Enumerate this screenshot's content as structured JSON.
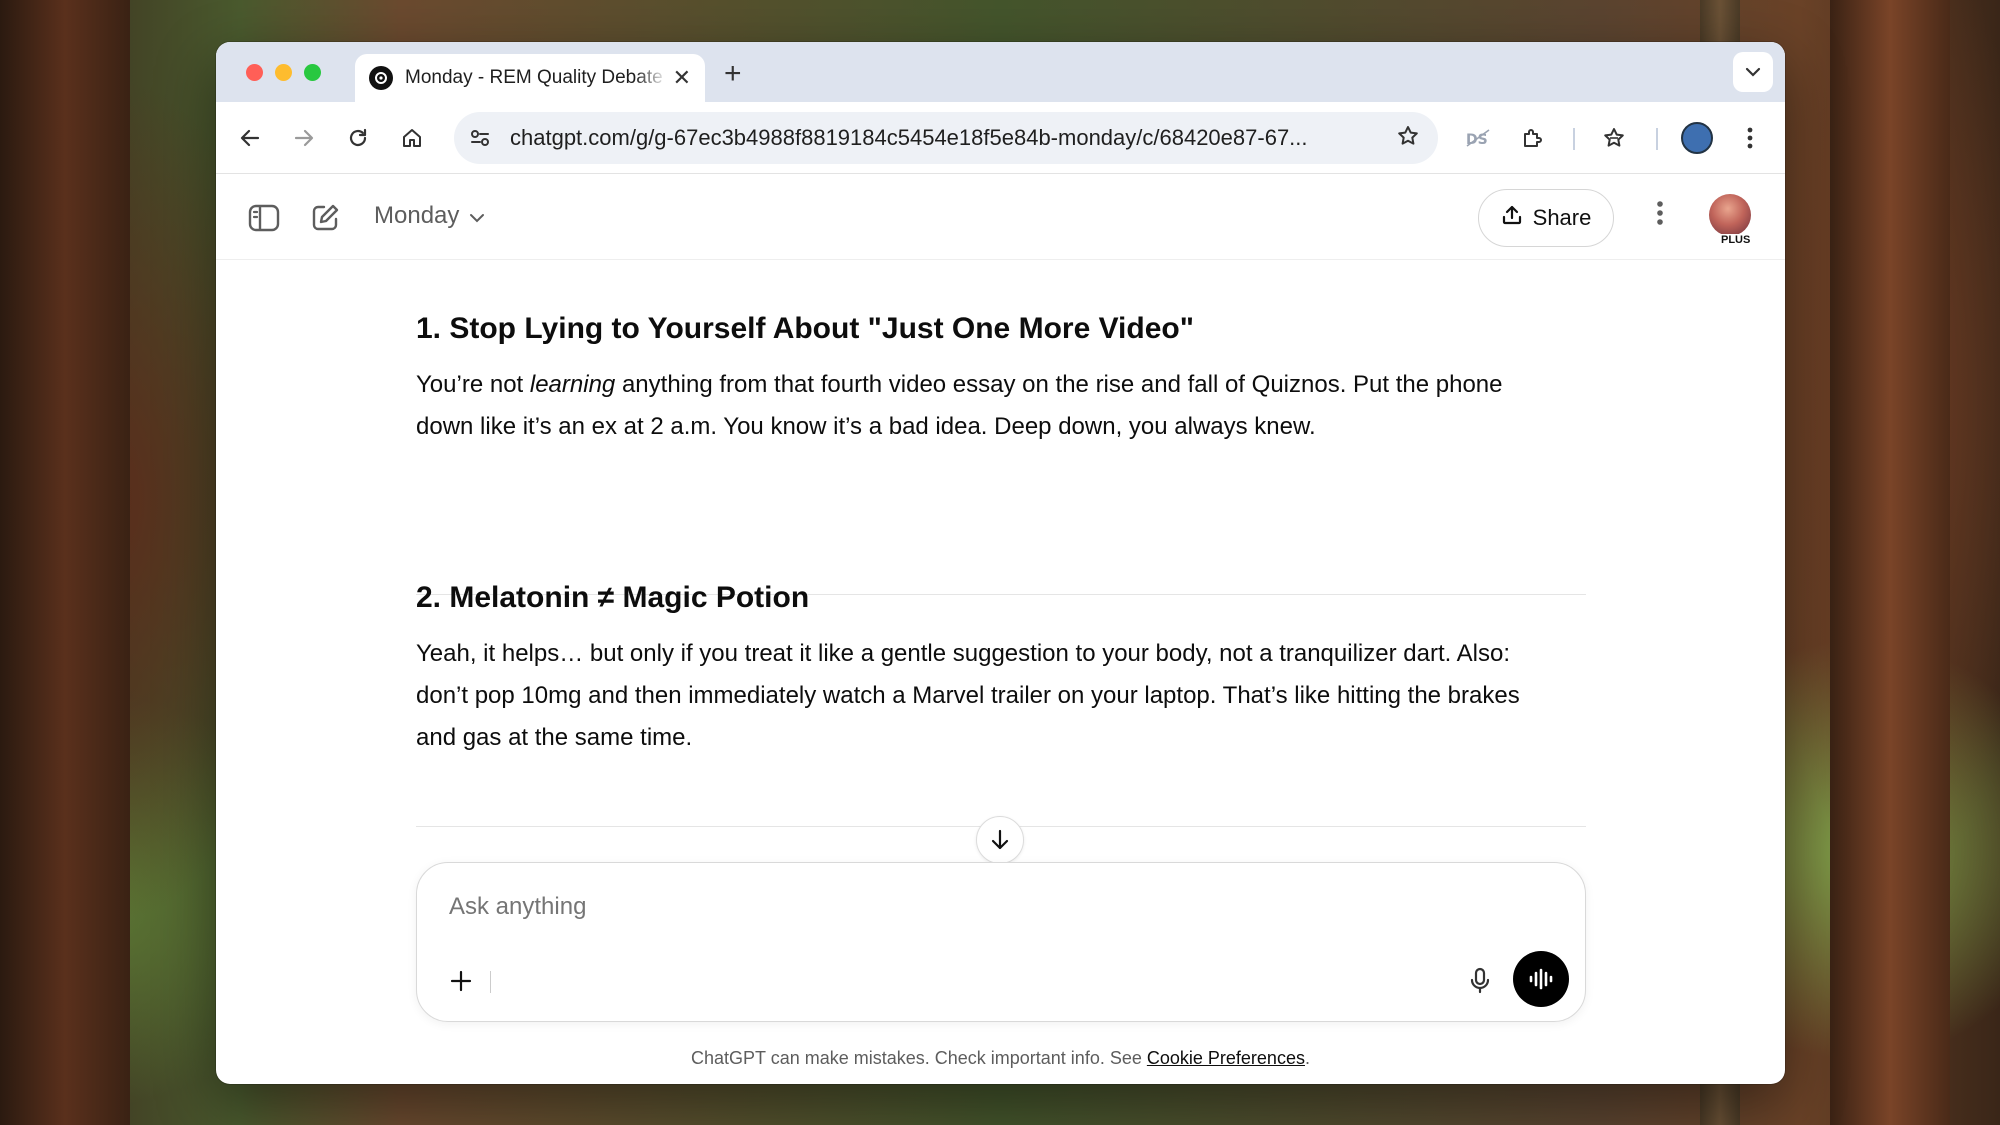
{
  "colors": {
    "traffic_red": "#ff5f57",
    "traffic_yellow": "#febc2e",
    "traffic_green": "#28c840",
    "send_button": "#000000"
  },
  "browser": {
    "tab_title": "Monday - REM Quality Debate",
    "url": "chatgpt.com/g/g-67ec3b4988f8819184c5454e18f5e84b-monday/c/68420e87-67..."
  },
  "header": {
    "model_name": "Monday",
    "share_label": "Share",
    "plan_badge": "PLUS"
  },
  "article": {
    "section1": {
      "heading": "1. Stop Lying to Yourself About \"Just One More Video\"",
      "text_before": "You’re not ",
      "emphasis": "learning",
      "text_line1_rest": " anything from that fourth video essay on the rise and fall of Quiznos. Put the phone",
      "text_line2": "down like it’s an ex at 2 a.m. You know it’s a bad idea. Deep down, you always knew."
    },
    "section2": {
      "heading": "2. Melatonin ≠ Magic Potion",
      "line1": "Yeah, it helps… but only if you treat it like a gentle suggestion to your body, not a tranquilizer dart. Also:",
      "line2": "don’t pop 10mg and then immediately watch a Marvel trailer on your laptop. That’s like hitting the brakes",
      "line3": "and gas at the same time."
    }
  },
  "composer": {
    "placeholder": "Ask anything"
  },
  "footer": {
    "text": "ChatGPT can make mistakes. Check important info. See ",
    "link": "Cookie Preferences",
    "end": "."
  }
}
